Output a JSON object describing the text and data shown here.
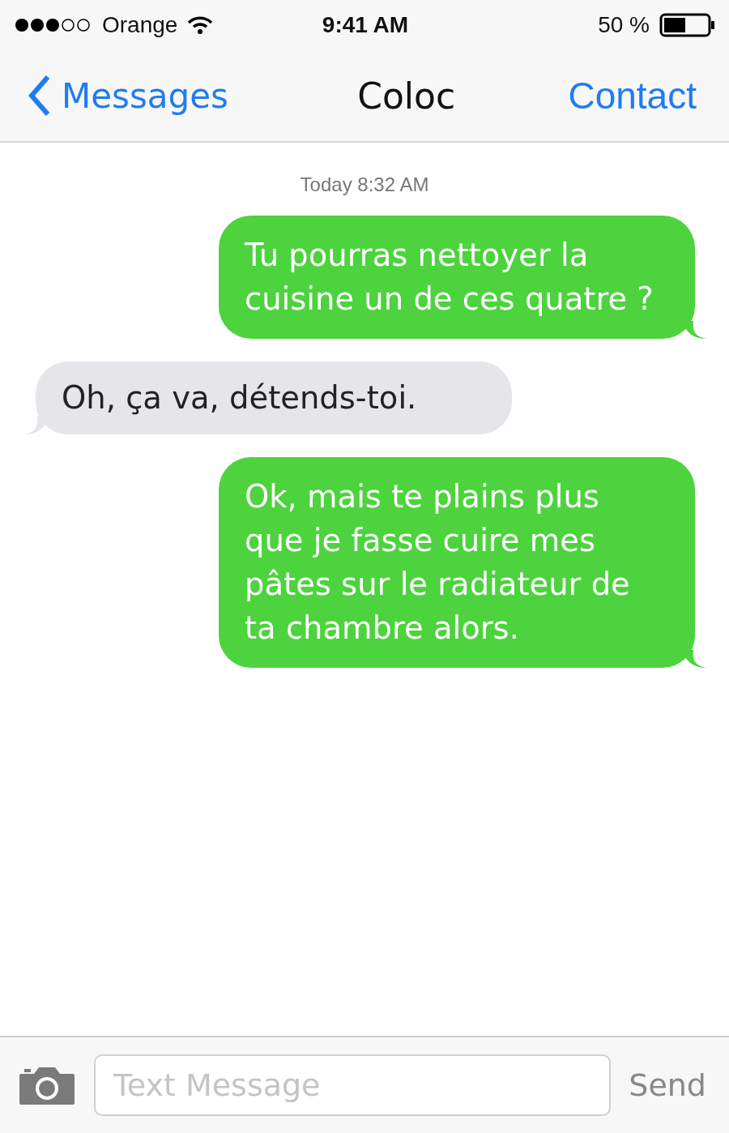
{
  "status_bar": {
    "carrier": "Orange",
    "time": "9:41 AM",
    "battery": "50 %"
  },
  "nav": {
    "back": "Messages",
    "title": "Coloc",
    "action": "Contact"
  },
  "timestamp": "Today 8:32 AM",
  "messages": [
    {
      "kind": "sent",
      "text": "Tu pourras nettoyer la cuisine un de ces quatre ?"
    },
    {
      "kind": "received",
      "text": "Oh, ça va, détends-toi."
    },
    {
      "kind": "sent",
      "text": "Ok, mais te plains plus que je fasse cuire mes pâtes sur le radiateur de ta chambre alors."
    }
  ],
  "composer": {
    "placeholder": "Text Message",
    "send": "Send"
  }
}
